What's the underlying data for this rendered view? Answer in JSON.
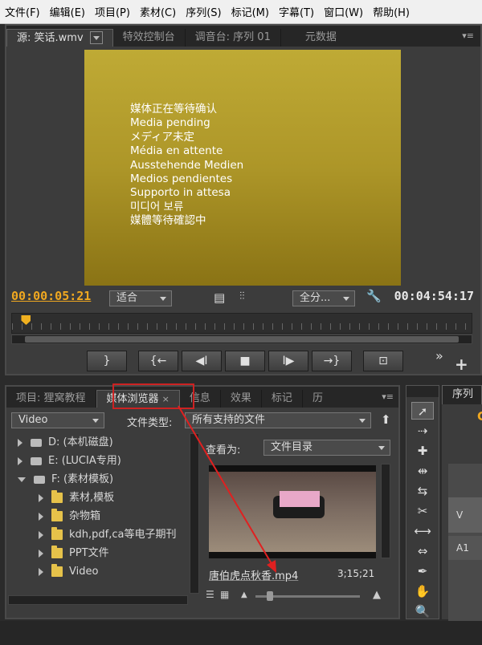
{
  "menubar": {
    "items": [
      "文件(F)",
      "编辑(E)",
      "项目(P)",
      "素材(C)",
      "序列(S)",
      "标记(M)",
      "字幕(T)",
      "窗口(W)",
      "帮助(H)"
    ]
  },
  "source_monitor": {
    "tabs": [
      "源: 笑话.wmv",
      "特效控制台",
      "调音台: 序列 01",
      "元数据"
    ],
    "pending_lines": [
      "媒体正在等待确认",
      "Media pending",
      "メディア未定",
      "Média en attente",
      "Ausstehende Medien",
      "Medios pendientes",
      "Supporto in attesa",
      "미디어 보류",
      "媒體等待確認中"
    ],
    "current_time": "00:00:05:21",
    "duration": "00:04:54:17",
    "zoom": "适合",
    "resolution": "全分...",
    "playhead_fraction": 0.02,
    "controls": [
      "}",
      "{←",
      "◀I",
      "■",
      "I▶",
      "→}",
      "⊡"
    ],
    "more_glyph": "»",
    "add_glyph": "+"
  },
  "media_browser": {
    "tabs": [
      "项目: 狸窝教程",
      "媒体浏览器",
      "信息",
      "效果",
      "标记",
      "历"
    ],
    "close_glyph": "×",
    "active_tab_color": "#cc2222",
    "left_dropdown": "Video",
    "file_type_label": "文件类型:",
    "file_type_value": "所有支持的文件",
    "view_label": "查看为:",
    "view_value": "文件目录",
    "tree": [
      {
        "label": "D: (本机磁盘)",
        "kind": "drive",
        "expanded": false
      },
      {
        "label": "E: (LUCIA专用)",
        "kind": "drive",
        "expanded": false
      },
      {
        "label": "F: (素材模板)",
        "kind": "drive",
        "expanded": true
      },
      {
        "label": "素材,模板",
        "kind": "folder",
        "expanded": false
      },
      {
        "label": "杂物箱",
        "kind": "folder",
        "expanded": false
      },
      {
        "label": "kdh,pdf,ca等电子期刊",
        "kind": "folder",
        "expanded": false
      },
      {
        "label": "PPT文件",
        "kind": "folder",
        "expanded": false
      },
      {
        "label": "Video",
        "kind": "folder",
        "expanded": false
      }
    ],
    "file": {
      "name": "唐伯虎点秋香.mp4",
      "duration": "3;15;21"
    },
    "arrow_color": "#e02020"
  },
  "tools": [
    "arrow-select",
    "track-select",
    "ripple-edit",
    "rolling-edit",
    "rate-stretch",
    "razor",
    "slip",
    "slide",
    "pen",
    "hand",
    "zoom"
  ],
  "timeline": {
    "title": "序列",
    "tracks": [
      "V",
      "A1"
    ]
  }
}
